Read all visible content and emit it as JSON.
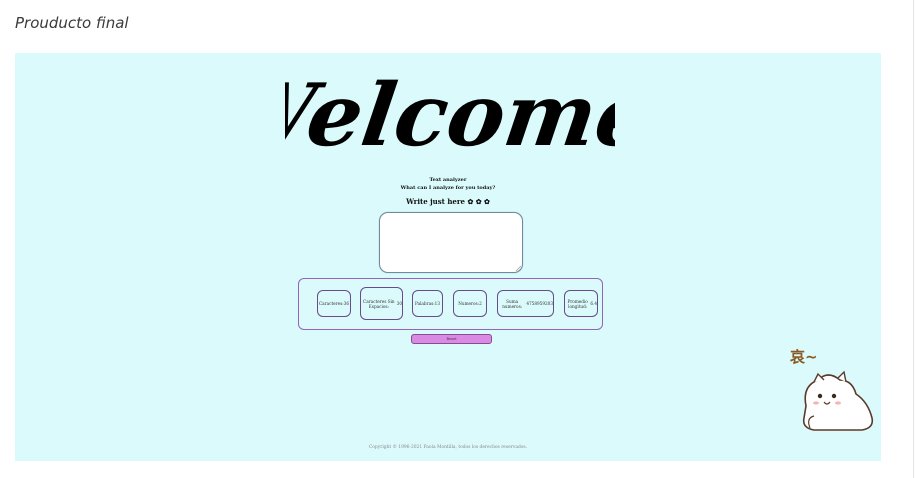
{
  "caption": "Prouducto final",
  "app": {
    "welcome": "Welcome!",
    "subtitle_line1": "Text analyzer",
    "subtitle_line2": "What can I analyze for you today?",
    "prompt": "Write just here ✿ ✿ ✿",
    "textarea_value": "",
    "stats": [
      {
        "label": "Caracteres:",
        "value": "36"
      },
      {
        "label": "Caracteres Sin Espacios:",
        "value": "30"
      },
      {
        "label": "Palabras:",
        "value": "13"
      },
      {
        "label": "Numeros:",
        "value": "2"
      },
      {
        "label": "Suma numeros:",
        "value": "4758959203"
      },
      {
        "label": "Promedio longitud:",
        "value": "6.4"
      }
    ],
    "button_label": "Reset",
    "footer": "Copyright © 1996-2021 Paola Montilla, todos los derechos reservados."
  },
  "sticker": {
    "text": "哀~",
    "name": "cat-sticker"
  },
  "colors": {
    "frame_bg": "#dafafc",
    "border_purple": "#9266b4",
    "button_pink": "#d98ae3"
  }
}
